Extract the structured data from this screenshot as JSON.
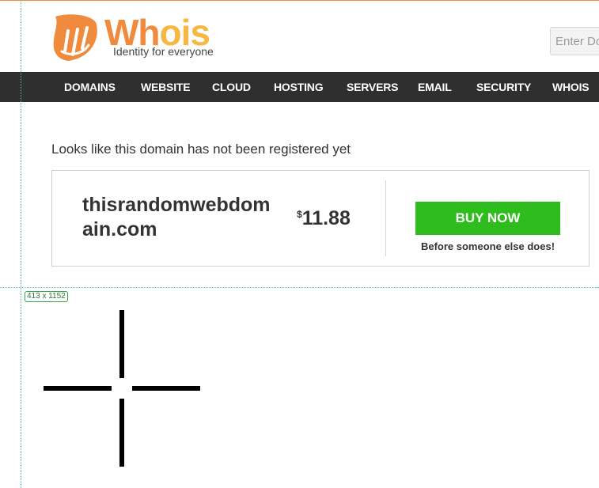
{
  "brand": {
    "name": "Whois",
    "name_part1": "Wh",
    "name_part2": "ois",
    "tagline": "Identity for everyone",
    "primary_color": "#f08a3c",
    "secondary_color": "#f6b843"
  },
  "search": {
    "placeholder": "Enter Domain"
  },
  "nav": {
    "items": [
      "DOMAINS",
      "WEBSITE",
      "CLOUD",
      "HOSTING",
      "SERVERS",
      "EMAIL",
      "SECURITY",
      "WHOIS"
    ]
  },
  "overlay": {
    "dimension_badge": "413 x 1152"
  },
  "result": {
    "notice": "Looks like this domain has not been registered yet",
    "domain": "thisrandomwebdomain.com",
    "currency_symbol": "$",
    "price": "11.88",
    "buy_label": "BUY NOW",
    "buy_subtext": "Before someone else does!",
    "buy_color": "#2fbd1e"
  },
  "cursor": {
    "icon": "crosshair-icon"
  }
}
